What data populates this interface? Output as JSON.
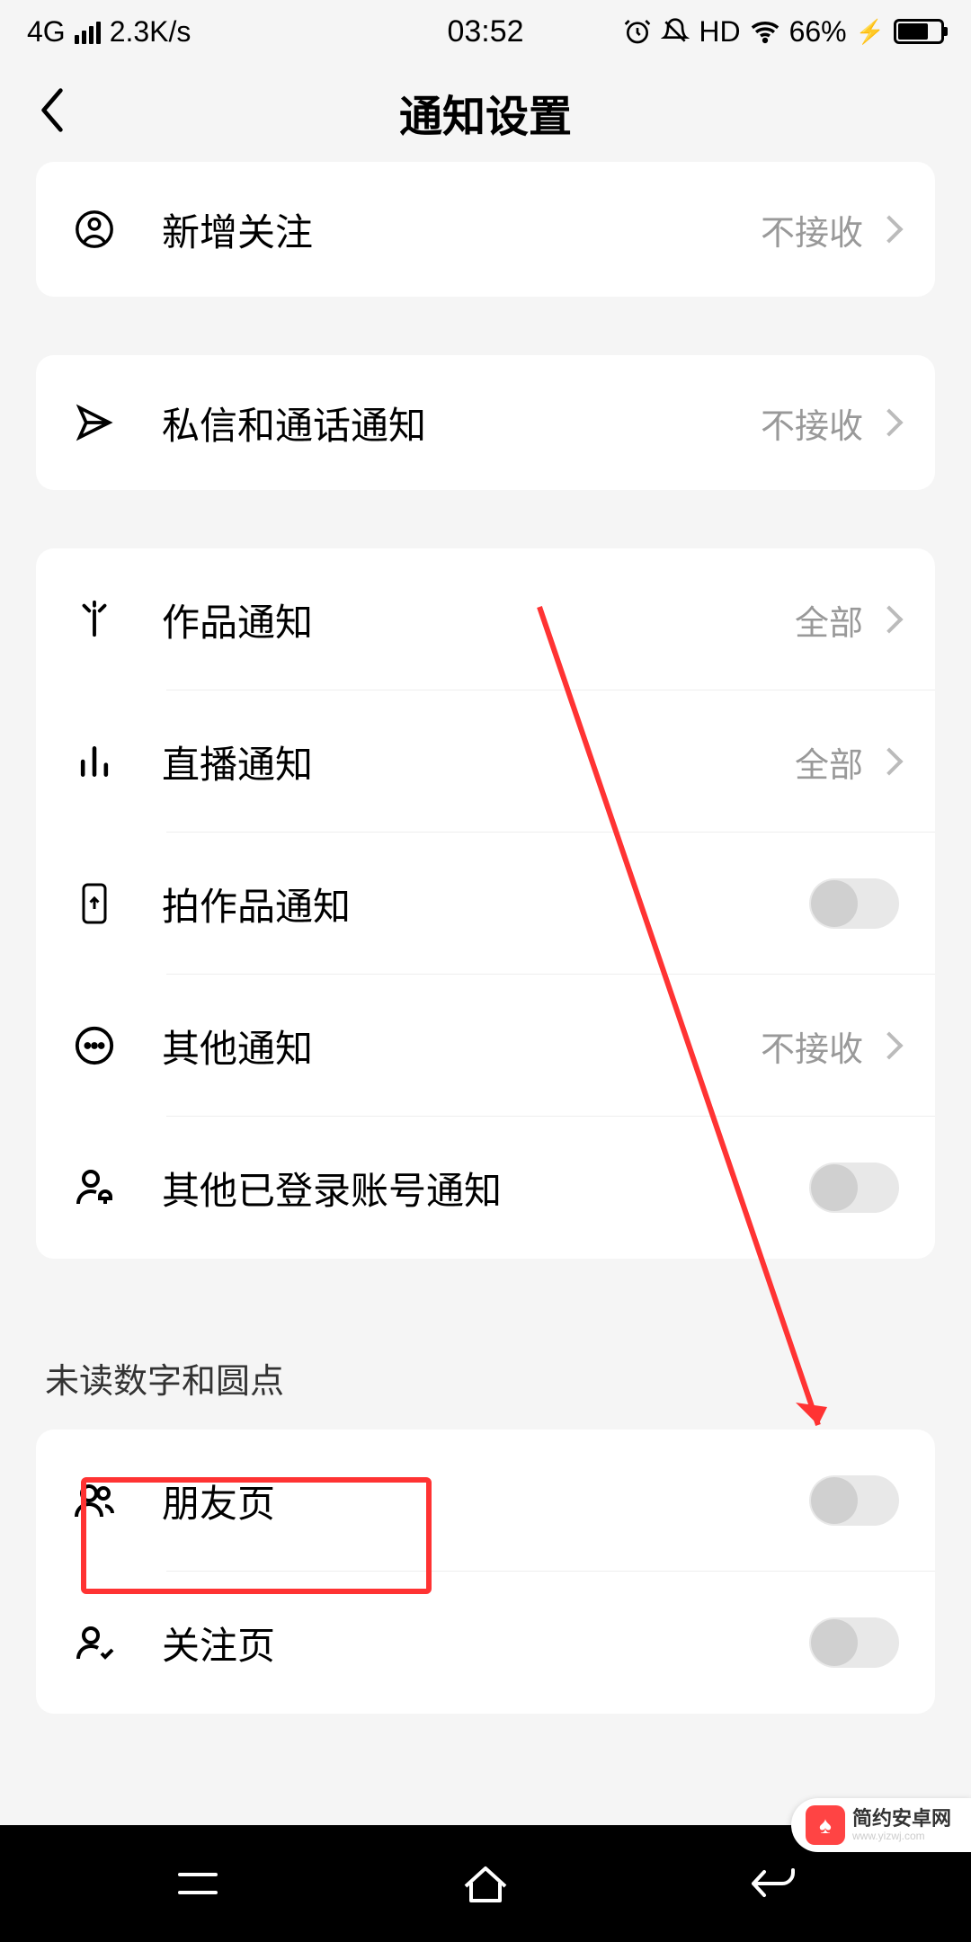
{
  "status": {
    "network": "4G",
    "speed": "2.3K/s",
    "time": "03:52",
    "hd": "HD",
    "battery": "66%"
  },
  "header": {
    "title": "通知设置"
  },
  "sections": {
    "s0": {
      "items": {
        "0": {
          "label": "新增关注",
          "value": "不接收"
        }
      }
    },
    "s1": {
      "items": {
        "0": {
          "label": "私信和通话通知",
          "value": "不接收"
        }
      }
    },
    "s2": {
      "items": {
        "0": {
          "label": "作品通知",
          "value": "全部"
        },
        "1": {
          "label": "直播通知",
          "value": "全部"
        },
        "2": {
          "label": "拍作品通知"
        },
        "3": {
          "label": "其他通知",
          "value": "不接收"
        },
        "4": {
          "label": "其他已登录账号通知"
        }
      }
    },
    "s3": {
      "title": "未读数字和圆点",
      "items": {
        "0": {
          "label": "朋友页"
        },
        "1": {
          "label": "关注页"
        }
      }
    }
  },
  "watermark": {
    "title": "简约安卓网",
    "sub": "www.yizwj.com"
  }
}
